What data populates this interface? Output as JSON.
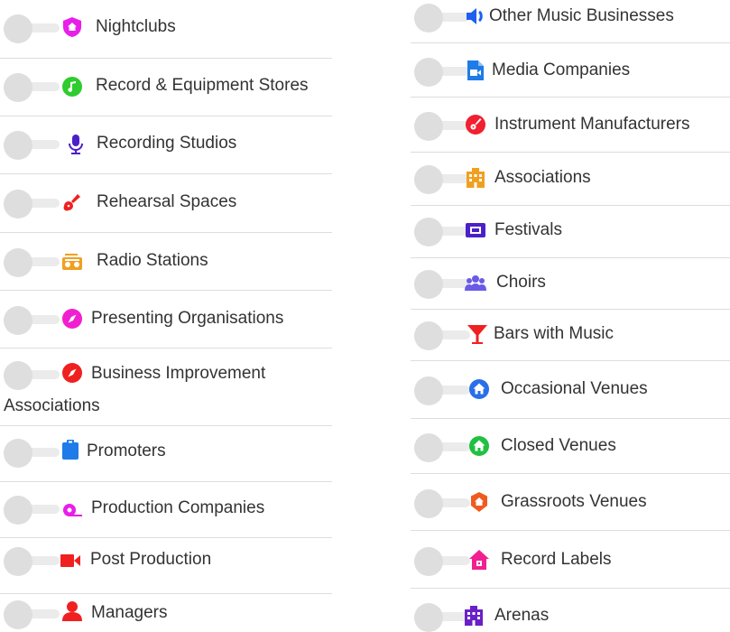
{
  "left_items": [
    {
      "label": "Nightclubs",
      "icon": "shield-home-icon",
      "color": "#e91ee9"
    },
    {
      "label": "Record & Equipment Stores",
      "icon": "music-note-icon",
      "color": "#2ecc2e"
    },
    {
      "label": "Recording Studios",
      "icon": "microphone-icon",
      "color": "#4b20c8"
    },
    {
      "label": "Rehearsal Spaces",
      "icon": "guitar-icon",
      "color": "#f02020"
    },
    {
      "label": "Radio Stations",
      "icon": "radio-icon",
      "color": "#f0a020"
    },
    {
      "label": "Presenting Organisations",
      "icon": "compass-icon",
      "color": "#f020d0"
    },
    {
      "label": "Business Improvement Associations",
      "icon": "compass-icon",
      "color": "#f02020"
    },
    {
      "label": "Promoters",
      "icon": "clipboard-icon",
      "color": "#1e7be8"
    },
    {
      "label": "Production Companies",
      "icon": "tape-icon",
      "color": "#e91ee9"
    },
    {
      "label": "Post Production",
      "icon": "video-camera-icon",
      "color": "#f02020"
    },
    {
      "label": "Managers",
      "icon": "user-icon",
      "color": "#f02020"
    }
  ],
  "right_items": [
    {
      "label": "Other Music Businesses",
      "icon": "speaker-icon",
      "color": "#1e5ff0"
    },
    {
      "label": "Media Companies",
      "icon": "video-file-icon",
      "color": "#1e7be8"
    },
    {
      "label": "Instrument Manufacturers",
      "icon": "guitar-circle-icon",
      "color": "#f02030"
    },
    {
      "label": "Associations",
      "icon": "building-icon",
      "color": "#f0a020"
    },
    {
      "label": "Festivals",
      "icon": "ticket-icon",
      "color": "#4b20c8"
    },
    {
      "label": "Choirs",
      "icon": "group-icon",
      "color": "#6a5ae8"
    },
    {
      "label": "Bars with Music",
      "icon": "cocktail-icon",
      "color": "#f02020"
    },
    {
      "label": "Occasional Venues",
      "icon": "home-circle-icon",
      "color": "#2a6fe8"
    },
    {
      "label": "Closed Venues",
      "icon": "home-circle-icon",
      "color": "#20c040"
    },
    {
      "label": "Grassroots Venues",
      "icon": "home-shield-icon",
      "color": "#f05a20"
    },
    {
      "label": "Record Labels",
      "icon": "house-icon",
      "color": "#f02090"
    },
    {
      "label": "Arenas",
      "icon": "building-icon",
      "color": "#6a20c8"
    }
  ]
}
